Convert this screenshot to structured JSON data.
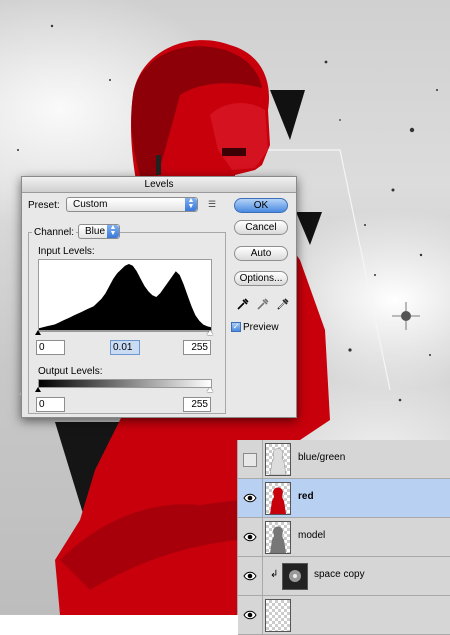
{
  "levels_dialog": {
    "title": "Levels",
    "preset_label": "Preset:",
    "preset_value": "Custom",
    "channel_label": "Channel:",
    "channel_value": "Blue",
    "input_levels_label": "Input Levels:",
    "input_black": "0",
    "input_gamma": "0.01",
    "input_white": "255",
    "output_levels_label": "Output Levels:",
    "output_black": "0",
    "output_white": "255",
    "buttons": {
      "ok": "OK",
      "cancel": "Cancel",
      "auto": "Auto",
      "options": "Options..."
    },
    "preview_label": "Preview",
    "preview_checked": true,
    "histogram": [
      2,
      3,
      4,
      5,
      6,
      8,
      10,
      12,
      14,
      16,
      18,
      20,
      22,
      24,
      26,
      30,
      34,
      40,
      48,
      56,
      62,
      66,
      70,
      72,
      70,
      64,
      56,
      48,
      42,
      38,
      36,
      40,
      46,
      52,
      58,
      64,
      60,
      50,
      38,
      26,
      16,
      10,
      6,
      4,
      3
    ]
  },
  "layers_panel": {
    "layers": [
      {
        "name": "blue/green",
        "visible": false,
        "active": false
      },
      {
        "name": "red",
        "visible": true,
        "active": true
      },
      {
        "name": "model",
        "visible": true,
        "active": false
      },
      {
        "name": "space copy",
        "visible": true,
        "active": false,
        "clipped": true
      }
    ]
  },
  "colors": {
    "accent_red": "#c8000c",
    "selection_blue": "#b8d1f2",
    "button_blue": "#4a8ae0"
  }
}
